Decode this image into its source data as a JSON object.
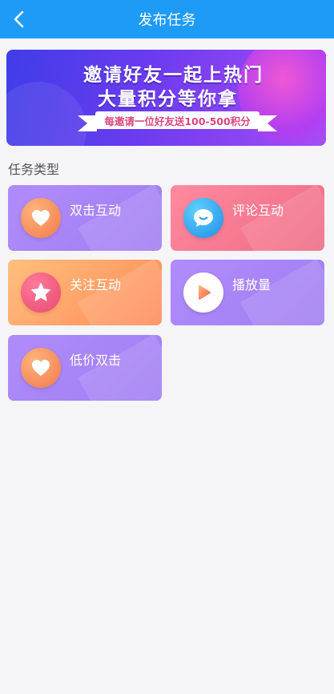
{
  "header": {
    "title": "发布任务",
    "back_icon": "chevron-left-icon"
  },
  "banner": {
    "line1": "邀请好友一起上热门",
    "line2": "大量积分等你拿",
    "ribbon": "每邀请一位好友送100-500积分"
  },
  "section": {
    "title": "任务类型"
  },
  "tasks": [
    {
      "label": "双击互动",
      "icon": "heart-icon",
      "color": "#a889f8"
    },
    {
      "label": "评论互动",
      "icon": "chat-bubble-icon",
      "color": "#f27a90"
    },
    {
      "label": "关注互动",
      "icon": "star-icon",
      "color": "#ffa268"
    },
    {
      "label": "播放量",
      "icon": "play-icon",
      "color": "#a889f8"
    },
    {
      "label": "低价双击",
      "icon": "heart-icon",
      "color": "#a889f8"
    }
  ],
  "colors": {
    "header": "#1e9bf6",
    "background": "#f5f5f7"
  }
}
